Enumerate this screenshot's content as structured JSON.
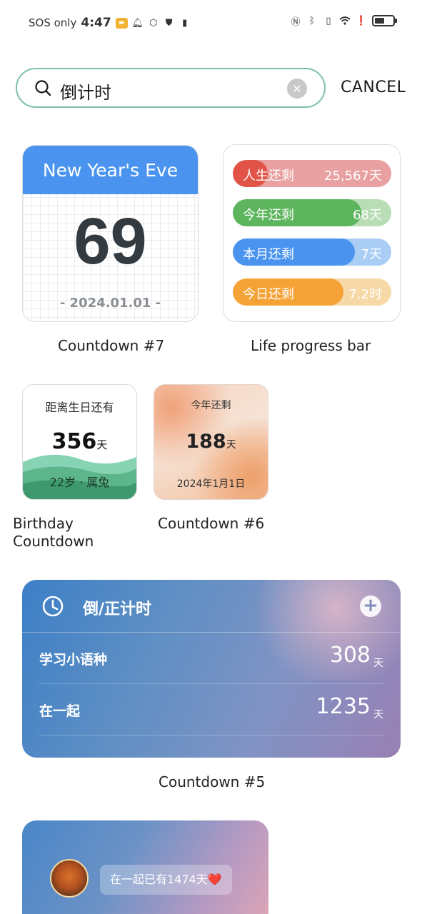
{
  "status_bar": {
    "carrier": "SOS only",
    "time": "4:47",
    "battery_level": 0.55
  },
  "search": {
    "query": "倒计时",
    "cancel_label": "CANCEL"
  },
  "widgets": {
    "new_year": {
      "header": "New Year's Eve",
      "days": "69",
      "date": "- 2024.01.01 -",
      "caption": "Countdown #7"
    },
    "life_progress": {
      "caption": "Life progress bar",
      "bars": [
        {
          "label": "人生还剩",
          "value": "25,567天",
          "progress": 0.22,
          "fill": "#e25347",
          "track": "#e8a0a0"
        },
        {
          "label": "今年还剩",
          "value": "68天",
          "progress": 0.81,
          "fill": "#5db55d",
          "track": "#b9ddb5"
        },
        {
          "label": "本月还剩",
          "value": "7天",
          "progress": 0.77,
          "fill": "#4a93ef",
          "track": "#a9cdf5"
        },
        {
          "label": "今日还剩",
          "value": "7.2时",
          "progress": 0.7,
          "fill": "#f5a337",
          "track": "#f7d9a8"
        }
      ]
    },
    "birthday": {
      "title": "距离生日还有",
      "days": "356",
      "unit": "天",
      "sub": "22岁 · 属兔",
      "caption_line1": "Birthday",
      "caption_line2": "Countdown"
    },
    "countdown6": {
      "title": "今年还剩",
      "days": "188",
      "unit": "天",
      "date": "2024年1月1日",
      "caption": "Countdown #6"
    },
    "countdown5": {
      "title": "倒/正计时",
      "caption": "Countdown #5",
      "rows": [
        {
          "name": "学习小语种",
          "value": "308",
          "unit": "天"
        },
        {
          "name": "在一起",
          "value": "1235",
          "unit": "天"
        }
      ]
    },
    "widget6": {
      "bubble_text": "在一起已有1474天❤️"
    }
  }
}
